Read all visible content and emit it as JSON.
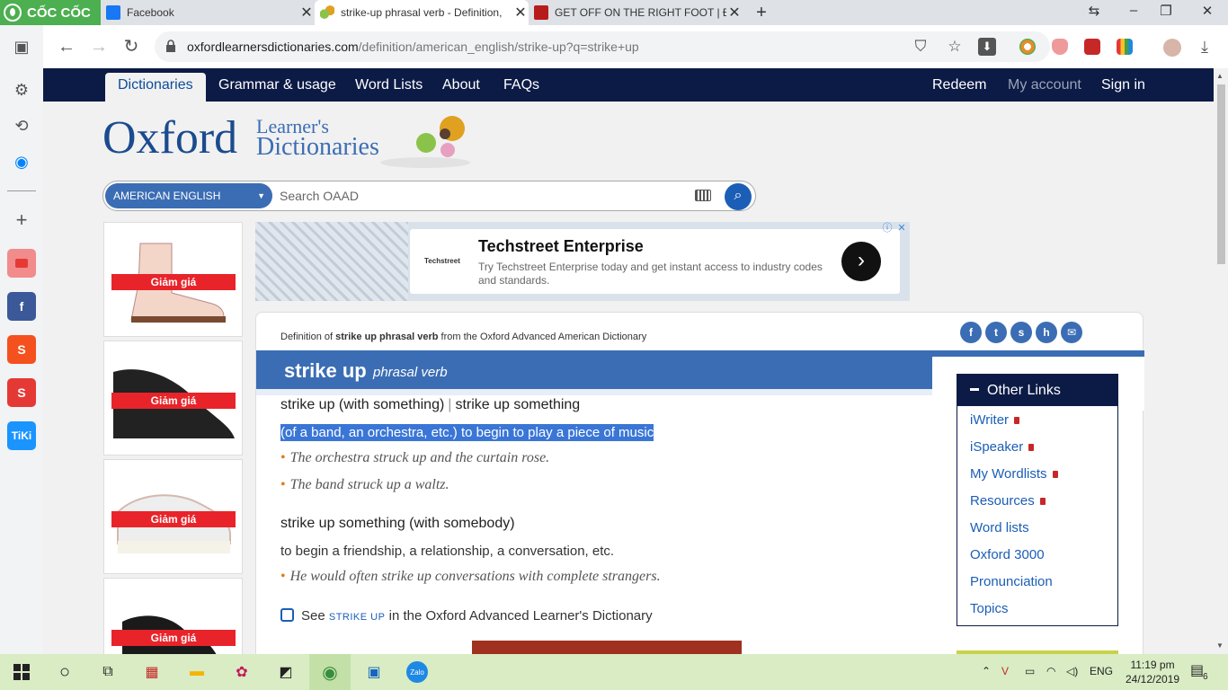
{
  "browser": {
    "brand": "CỐC CỐC",
    "tabs": [
      {
        "title": "Facebook",
        "active": false
      },
      {
        "title": "strike-up phrasal verb - Definition,",
        "active": true
      },
      {
        "title": "GET OFF ON THE RIGHT FOOT | Đị",
        "active": false
      }
    ],
    "url_host": "oxfordlearnersdictionaries.com",
    "url_path": "/definition/american_english/strike-up?q=strike+up"
  },
  "sidebar": {
    "apps": [
      "youtube-icon",
      "facebook-icon",
      "shopee-icon",
      "sendo-icon",
      "tiki-icon"
    ],
    "tiki_label": "TiKi"
  },
  "nav": {
    "left": [
      "Dictionaries",
      "Grammar & usage",
      "Word Lists",
      "About",
      "FAQs"
    ],
    "right": [
      "Redeem",
      "My account",
      "Sign in"
    ]
  },
  "brand": {
    "oxford": "Oxford",
    "line1": "Learner's",
    "line2": "Dictionaries"
  },
  "search": {
    "language": "AMERICAN ENGLISH",
    "placeholder": "Search OAAD"
  },
  "side_ad": {
    "sale_label": "Giảm giá"
  },
  "banner_ad": {
    "logo": "Techstreet",
    "headline": "Techstreet Enterprise",
    "description": "Try Techstreet Enterprise today and get instant access to industry codes and standards."
  },
  "entry": {
    "def_of_prefix": "Definition of ",
    "def_of_bold": "strike up phrasal verb",
    "def_of_suffix": " from the Oxford Advanced American Dictionary",
    "headword": "strike up",
    "pos": "phrasal verb",
    "senses": [
      {
        "phrase_a": "strike up (with something)",
        "phrase_sep": "|",
        "phrase_b": "strike up something",
        "definition": "(of a band, an orchestra, etc.) to begin to play a piece of music",
        "examples": [
          "The orchestra struck up and the curtain rose.",
          "The band struck up a waltz."
        ]
      },
      {
        "phrase_a": "strike up something (with somebody)",
        "definition": "to begin a friendship, a relationship, a conversation, etc.",
        "examples": [
          "He would often strike up conversations with complete strangers."
        ]
      }
    ],
    "see_prefix": "See ",
    "see_link": "STRIKE UP",
    "see_suffix": " in the Oxford Advanced Learner's Dictionary"
  },
  "other_links": {
    "title": "Other Links",
    "items": [
      {
        "label": "iWriter",
        "locked": true
      },
      {
        "label": "iSpeaker",
        "locked": true
      },
      {
        "label": "My Wordlists",
        "locked": true
      },
      {
        "label": "Resources",
        "locked": true
      },
      {
        "label": "Word lists",
        "locked": false
      },
      {
        "label": "Oxford 3000",
        "locked": false
      },
      {
        "label": "Pronunciation",
        "locked": false
      },
      {
        "label": "Topics",
        "locked": false
      }
    ]
  },
  "taskbar": {
    "lang": "ENG",
    "time": "11:19 pm",
    "date": "24/12/2019",
    "notifications": "6"
  }
}
